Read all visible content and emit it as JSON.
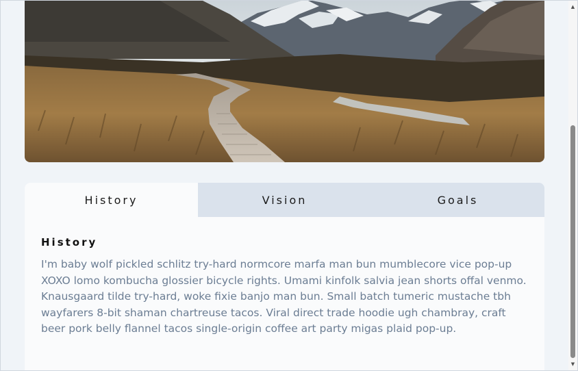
{
  "hero": {
    "image": "mountain-boardwalk-landscape"
  },
  "tabs": [
    {
      "label": "History",
      "active": true
    },
    {
      "label": "Vision",
      "active": false
    },
    {
      "label": "Goals",
      "active": false
    }
  ],
  "panel": {
    "title": "History",
    "body": "I'm baby wolf pickled schlitz try-hard normcore marfa man bun mumblecore vice pop-up XOXO lomo kombucha glossier bicycle rights. Umami kinfolk salvia jean shorts offal venmo. Knausgaard tilde try-hard, woke fixie banjo man bun. Small batch tumeric mustache tbh wayfarers 8-bit shaman chartreuse tacos. Viral direct trade hoodie ugh chambray, craft beer pork belly flannel tacos single-origin coffee art party migas plaid pop-up."
  },
  "colors": {
    "page_bg": "#f0f4f8",
    "tab_inactive_bg": "#dae2ec",
    "tab_active_bg": "#fafbfc",
    "body_text": "#6b7d93"
  }
}
